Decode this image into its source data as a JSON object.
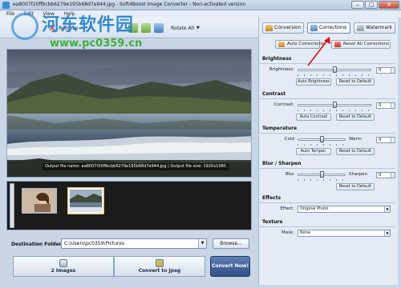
{
  "window": {
    "title": "ea8007f20ffbcbb6279e195b68d7e944.jpg - Soft4Boost Image Converter - Non-activated version"
  },
  "menu": [
    "File",
    "Edit",
    "View",
    "Help"
  ],
  "toolbar": {
    "remove_label": "Remove",
    "rotate_label": "Rotate All"
  },
  "watermark": {
    "text": "河东软件园",
    "url": "www.pc0359.cn"
  },
  "preview": {
    "info": "Output file name: ea8007f20ffbcbb6279e195b68d7e944.jpg | Output file size: 1920x1080"
  },
  "destination": {
    "label": "Destination Folder:",
    "value": "C:\\Users\\pc0359\\Pictures",
    "browse_label": "Browse..."
  },
  "steps": {
    "step1": "2 Images",
    "step2": "Convert to Jpeg",
    "convert": "Convert Now!"
  },
  "tabs": {
    "conversion": "Conversion",
    "corrections": "Corrections",
    "watermark": "Watermark"
  },
  "actions": {
    "auto_corrections": "Auto Corrections",
    "reset_all": "Reset All Corrections"
  },
  "brightness": {
    "header": "Brightness",
    "label": "Brightness:",
    "value": "0",
    "auto_btn": "Auto Brightness",
    "reset_btn": "Reset to Default"
  },
  "contrast": {
    "header": "Contrast",
    "label": "Contrast:",
    "value": "0",
    "auto_btn": "Auto Contrast",
    "reset_btn": "Reset to Default"
  },
  "temperature": {
    "header": "Temperature",
    "cold": "Cold",
    "warm": "Warm",
    "value": "0",
    "auto_btn": "Auto Temper.",
    "reset_btn": "Reset to Default"
  },
  "blur": {
    "header": "Blur / Sharpen",
    "blur": "Blur",
    "sharpen": "Sharpen",
    "value": "0",
    "reset_btn": "Reset to Default"
  },
  "effects": {
    "header": "Effects",
    "label": "Effect:",
    "value": "Original Photo"
  },
  "texture": {
    "header": "Texture",
    "label": "Mask:",
    "value": "None"
  },
  "sliders": {
    "brightness": 0.5,
    "contrast": 0.5,
    "temperature": 0.5,
    "blur": 0.5
  }
}
